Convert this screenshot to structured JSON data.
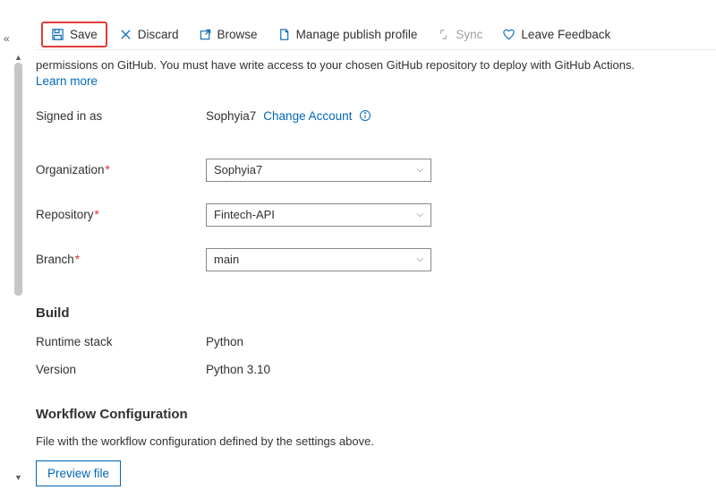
{
  "toolbar": {
    "save": "Save",
    "discard": "Discard",
    "browse": "Browse",
    "manage": "Manage publish profile",
    "sync": "Sync",
    "feedback": "Leave Feedback"
  },
  "help": {
    "line": "permissions on GitHub. You must have write access to your chosen GitHub repository to deploy with GitHub Actions.",
    "learn": "Learn more"
  },
  "signedIn": {
    "label": "Signed in as",
    "user": "Sophyia7",
    "change": "Change Account"
  },
  "org": {
    "label": "Organization",
    "value": "Sophyia7"
  },
  "repo": {
    "label": "Repository",
    "value": "Fintech-API"
  },
  "branch": {
    "label": "Branch",
    "value": "main"
  },
  "build": {
    "heading": "Build",
    "runtimeLabel": "Runtime stack",
    "runtimeValue": "Python",
    "versionLabel": "Version",
    "versionValue": "Python 3.10"
  },
  "workflow": {
    "heading": "Workflow Configuration",
    "desc": "File with the workflow configuration defined by the settings above.",
    "preview": "Preview file"
  }
}
